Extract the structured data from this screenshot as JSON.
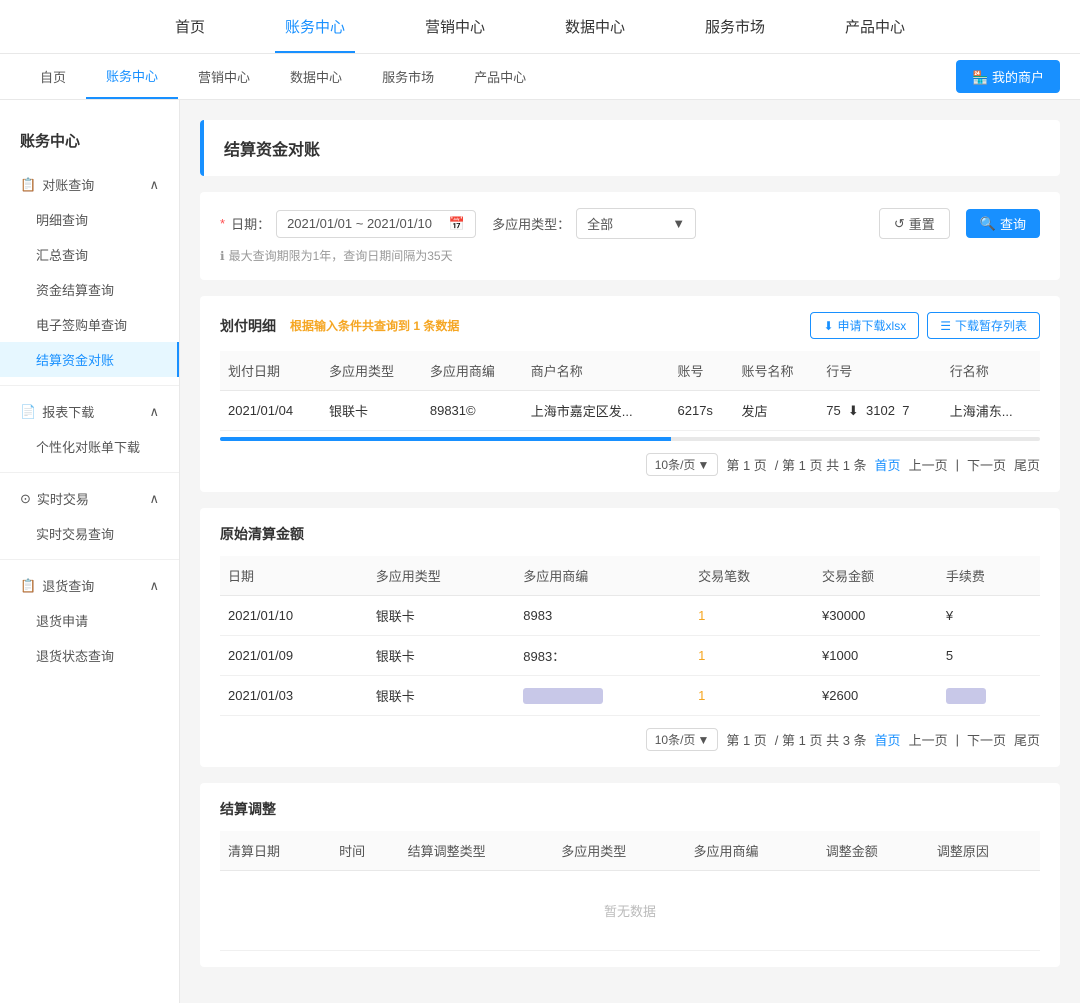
{
  "topNav": {
    "items": [
      {
        "label": "首页",
        "active": false
      },
      {
        "label": "账务中心",
        "active": true
      },
      {
        "label": "营销中心",
        "active": false
      },
      {
        "label": "数据中心",
        "active": false
      },
      {
        "label": "服务市场",
        "active": false
      },
      {
        "label": "产品中心",
        "active": false
      }
    ]
  },
  "secondNav": {
    "items": [
      {
        "label": "自页",
        "active": false
      },
      {
        "label": "账务中心",
        "active": true
      },
      {
        "label": "营销中心",
        "active": false
      },
      {
        "label": "数据中心",
        "active": false
      },
      {
        "label": "服务市场",
        "active": false
      },
      {
        "label": "产品中心",
        "active": false
      }
    ],
    "myMerchantBtn": "🏪 我的商户"
  },
  "sidebar": {
    "title": "账务中心",
    "groups": [
      {
        "label": "对账查询",
        "icon": "📋",
        "expanded": true,
        "items": [
          {
            "label": "明细查询",
            "active": false
          },
          {
            "label": "汇总查询",
            "active": false
          },
          {
            "label": "资金结算查询",
            "active": false
          },
          {
            "label": "电子签购单查询",
            "active": false
          },
          {
            "label": "结算资金对账",
            "active": true
          }
        ]
      },
      {
        "label": "报表下载",
        "icon": "📄",
        "expanded": true,
        "items": [
          {
            "label": "个性化对账单下载",
            "active": false
          }
        ]
      },
      {
        "label": "实时交易",
        "icon": "⊙",
        "expanded": true,
        "items": [
          {
            "label": "实时交易查询",
            "active": false
          }
        ]
      },
      {
        "label": "退货查询",
        "icon": "📋",
        "expanded": true,
        "items": [
          {
            "label": "退货申请",
            "active": false
          },
          {
            "label": "退货状态查询",
            "active": false
          }
        ]
      }
    ]
  },
  "pageTitle": "结算资金对账",
  "filterBar": {
    "dateLabel": "日期：",
    "dateValue": "2021/01/01 ~ 2021/01/10",
    "appTypeLabel": "多应用类型：",
    "appTypeValue": "全部",
    "resetLabel": "重置",
    "queryLabel": "查询",
    "note": "最大查询期限为1年，查询日期间隔为35天"
  },
  "paymentDetail": {
    "title": "划付明细",
    "metaText": "根据输入条件共查询到",
    "count": "1",
    "countSuffix": "条数据",
    "downloadXlsxBtn": "申请下载xlsx",
    "downloadStoreBtn": "下载暂存列表",
    "columns": [
      "划付日期",
      "多应用类型",
      "多应用商编",
      "商户名称",
      "账号",
      "账号名称",
      "行号",
      "行名称"
    ],
    "rows": [
      {
        "date": "2021/01/04",
        "appType": "银联卡",
        "appCode": "89831©",
        "merchantName": "上海市嘉定区发...",
        "account": "6217s",
        "accountName": "发店",
        "bankCode": "75",
        "bankNo": "3102",
        "bankRank": "7",
        "bankName": "上海浦东..."
      }
    ],
    "pagination": {
      "pageSize": "10条/页",
      "current": "第 1 页",
      "total": "/ 第 1 页 共 1 条",
      "first": "首页",
      "prev": "上一页",
      "next": "下一页",
      "last": "尾页"
    }
  },
  "originalSettlement": {
    "title": "原始清算金额",
    "columns": [
      "日期",
      "多应用类型",
      "多应用商编",
      "交易笔数",
      "交易金额",
      "手续费"
    ],
    "rows": [
      {
        "date": "2021/01/10",
        "appType": "银联卡",
        "appCode": "8983",
        "tradeCount": "1",
        "amount": "¥30000",
        "fee": "¥",
        "feeBlur": false
      },
      {
        "date": "2021/01/09",
        "appType": "银联卡",
        "appCode": "8983：",
        "tradeCount": "1",
        "amount": "¥1000",
        "fee": "5",
        "feeBlur": false
      },
      {
        "date": "2021/01/03",
        "appType": "银联卡",
        "appCode": "8983blur",
        "tradeCount": "1",
        "amount": "¥2600",
        "fee": "blur",
        "feeBlur": true
      }
    ],
    "pagination": {
      "pageSize": "10条/页",
      "current": "第 1 页",
      "total": "/ 第 1 页 共 3 条",
      "first": "首页",
      "prev": "上一页",
      "next": "下一页",
      "last": "尾页"
    }
  },
  "settlementAdjust": {
    "title": "结算调整",
    "columns": [
      "清算日期",
      "时间",
      "结算调整类型",
      "多应用类型",
      "多应用商编",
      "调整金额",
      "调整原因"
    ],
    "emptyText": "暂无数据"
  },
  "icons": {
    "calendar": "📅",
    "chevronDown": "▼",
    "refresh": "↺",
    "search": "🔍",
    "download": "⬇",
    "info": "ℹ",
    "shield": "🔒"
  }
}
